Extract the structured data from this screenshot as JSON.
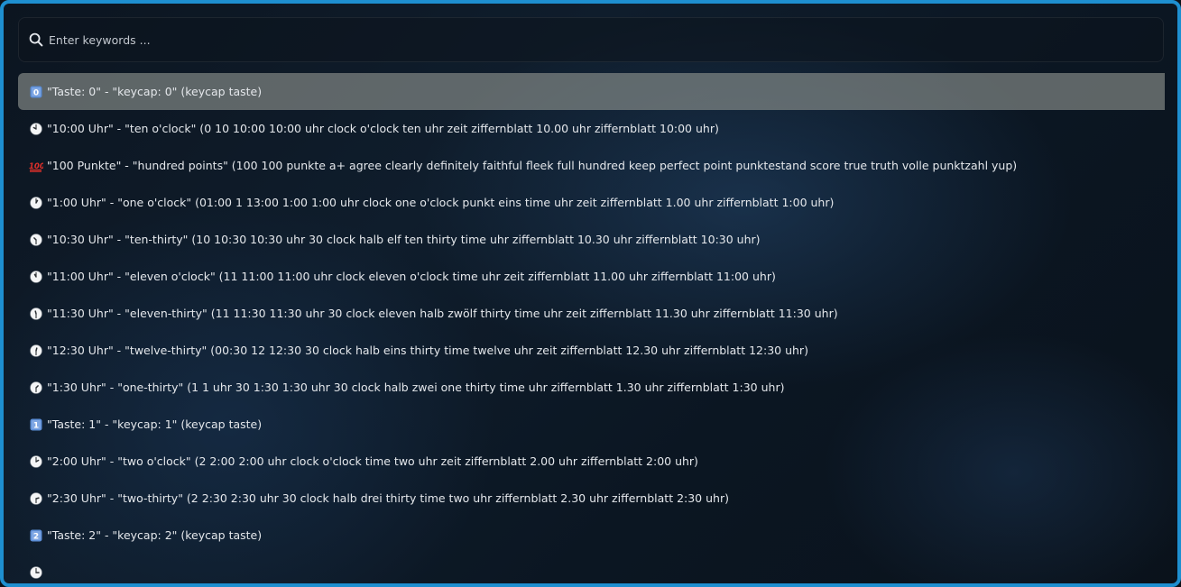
{
  "search": {
    "placeholder": "Enter keywords ...",
    "value": ""
  },
  "results": [
    {
      "icon": "keycap-0-icon",
      "text": "\"Taste: 0\" - \"keycap: 0\"  (keycap taste)"
    },
    {
      "icon": "clock-ten-oclock-icon",
      "text": "\"10:00 Uhr\" - \"ten o'clock\"  (0 10 10:00 10:00 uhr clock o'clock ten uhr zeit ziffernblatt 10.00 uhr ziffernblatt 10:00 uhr)"
    },
    {
      "icon": "hundred-points-icon",
      "text": "\"100 Punkte\" - \"hundred points\"  (100 100 punkte a+ agree clearly definitely faithful fleek full hundred keep perfect point punktestand score true truth volle punktzahl yup)"
    },
    {
      "icon": "clock-one-oclock-icon",
      "text": "\"1:00 Uhr\" - \"one o'clock\"  (01:00 1 13:00 1:00 1:00 uhr clock one o'clock punkt eins time uhr zeit ziffernblatt 1.00 uhr ziffernblatt 1:00 uhr)"
    },
    {
      "icon": "clock-ten-thirty-icon",
      "text": "\"10:30 Uhr\" - \"ten-thirty\"  (10 10:30 10:30 uhr 30 clock halb elf ten thirty time uhr ziffernblatt 10.30 uhr ziffernblatt 10:30 uhr)"
    },
    {
      "icon": "clock-eleven-oclock-icon",
      "text": "\"11:00 Uhr\" - \"eleven o'clock\"  (11 11:00 11:00 uhr clock eleven o'clock time uhr zeit ziffernblatt 11.00 uhr ziffernblatt 11:00 uhr)"
    },
    {
      "icon": "clock-eleven-thirty-icon",
      "text": "\"11:30 Uhr\" - \"eleven-thirty\"  (11 11:30 11:30 uhr 30 clock eleven halb zwölf thirty time uhr zeit ziffernblatt 11.30 uhr ziffernblatt 11:30 uhr)"
    },
    {
      "icon": "clock-twelve-thirty-icon",
      "text": "\"12:30 Uhr\" - \"twelve-thirty\"  (00:30 12 12:30 30 clock halb eins thirty time twelve uhr zeit ziffernblatt 12.30 uhr ziffernblatt 12:30 uhr)"
    },
    {
      "icon": "clock-one-thirty-icon",
      "text": "\"1:30 Uhr\" - \"one-thirty\"  (1 1 uhr 30 1:30 1:30 uhr 30 clock halb zwei one thirty time uhr ziffernblatt 1.30 uhr ziffernblatt 1:30 uhr)"
    },
    {
      "icon": "keycap-1-icon",
      "text": "\"Taste: 1\" - \"keycap: 1\"  (keycap taste)"
    },
    {
      "icon": "clock-two-oclock-icon",
      "text": "\"2:00 Uhr\" - \"two o'clock\"  (2 2:00 2:00 uhr clock o'clock time two uhr zeit ziffernblatt 2.00 uhr ziffernblatt 2:00 uhr)"
    },
    {
      "icon": "clock-two-thirty-icon",
      "text": "\"2:30 Uhr\" - \"two-thirty\"  (2 2:30 2:30 uhr 30 clock halb drei thirty time two uhr ziffernblatt 2.30 uhr ziffernblatt 2:30 uhr)"
    },
    {
      "icon": "keycap-2-icon",
      "text": "\"Taste: 2\" - \"keycap: 2\"  (keycap taste)"
    },
    {
      "icon": "clock-icon",
      "text": ""
    }
  ],
  "colors": {
    "border": "#1e8fd0",
    "selected_row": "#8f9490",
    "text": "#e4e7eb",
    "keycap_blue": "#5b8dd6",
    "hundred_red": "#e0302a"
  }
}
